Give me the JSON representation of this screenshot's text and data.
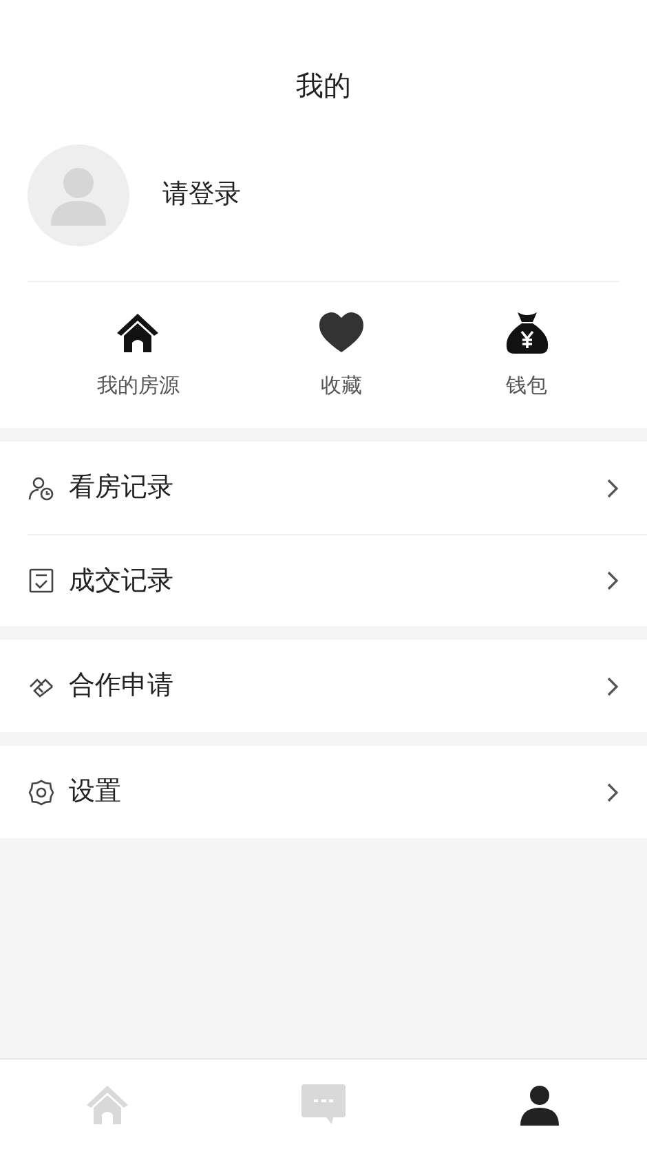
{
  "header": {
    "title": "我的"
  },
  "profile": {
    "login_text": "请登录"
  },
  "shortcuts": [
    {
      "kind": "house",
      "label": "我的房源"
    },
    {
      "kind": "heart",
      "label": "收藏"
    },
    {
      "kind": "moneybag",
      "label": "钱包"
    }
  ],
  "menu_groups": [
    [
      {
        "kind": "visit",
        "label": "看房记录"
      },
      {
        "kind": "deal",
        "label": "成交记录"
      }
    ],
    [
      {
        "kind": "cooperate",
        "label": "合作申请"
      }
    ],
    [
      {
        "kind": "settings",
        "label": "设置"
      }
    ]
  ],
  "tab_bar": [
    {
      "kind": "home",
      "selected": false
    },
    {
      "kind": "message",
      "selected": false
    },
    {
      "kind": "profile",
      "selected": true
    }
  ]
}
